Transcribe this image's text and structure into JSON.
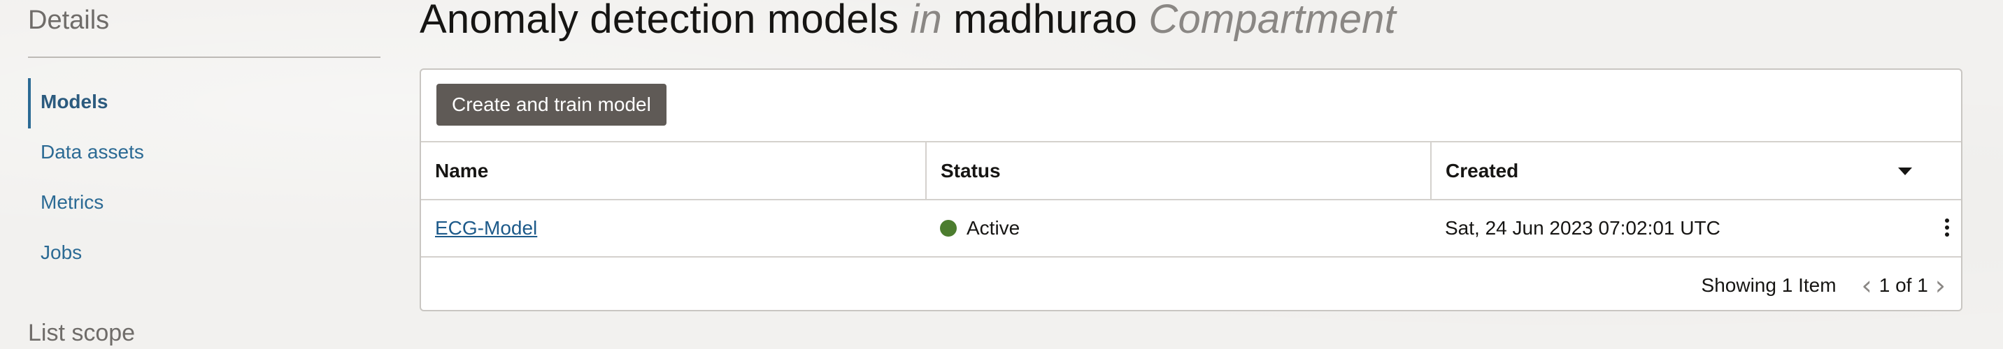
{
  "sidebar": {
    "heading": "Details",
    "items": [
      {
        "label": "Models",
        "active": true
      },
      {
        "label": "Data assets",
        "active": false
      },
      {
        "label": "Metrics",
        "active": false
      },
      {
        "label": "Jobs",
        "active": false
      }
    ],
    "subheading": "List scope"
  },
  "page": {
    "title_main": "Anomaly detection models",
    "title_in": "in",
    "title_compartment_name": "madhurao",
    "title_compartment_label": "Compartment"
  },
  "toolbar": {
    "create_button": "Create and train model"
  },
  "table": {
    "columns": [
      "Name",
      "Status",
      "Created"
    ],
    "rows": [
      {
        "name": "ECG-Model",
        "status": "Active",
        "created": "Sat, 24 Jun 2023 07:02:01 UTC"
      }
    ],
    "sort_icon": "caret-down-icon",
    "row_action_icon": "kebab-menu-icon"
  },
  "pagination": {
    "showing": "Showing 1 Item",
    "page_of": "1 of 1"
  },
  "colors": {
    "link": "#1d5a8a",
    "nav": "#2b6a94",
    "status_active": "#4c7d2f",
    "button_bg": "#5f5a56"
  }
}
